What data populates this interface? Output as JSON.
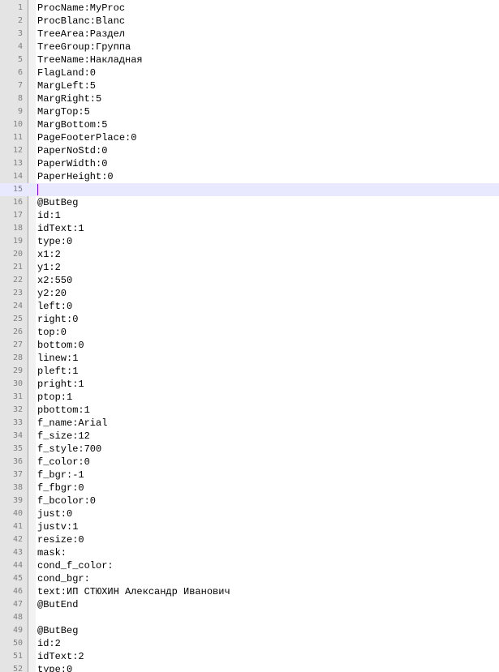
{
  "colors": {
    "gutter_bg": "#e4e4e4",
    "line_number": "#808080",
    "current_line_bg": "#e8e8ff",
    "caret": "#8000ff",
    "text": "#000000"
  },
  "current_line": 15,
  "lines": [
    {
      "n": "1",
      "text": "ProcName:MyProc"
    },
    {
      "n": "2",
      "text": "ProcBlanc:Blanc"
    },
    {
      "n": "3",
      "text": "TreeArea:Раздел"
    },
    {
      "n": "4",
      "text": "TreeGroup:Группа"
    },
    {
      "n": "5",
      "text": "TreeName:Накладная"
    },
    {
      "n": "6",
      "text": "FlagLand:0"
    },
    {
      "n": "7",
      "text": "MargLeft:5"
    },
    {
      "n": "8",
      "text": "MargRight:5"
    },
    {
      "n": "9",
      "text": "MargTop:5"
    },
    {
      "n": "10",
      "text": "MargBottom:5"
    },
    {
      "n": "11",
      "text": "PageFooterPlace:0"
    },
    {
      "n": "12",
      "text": "PaperNoStd:0"
    },
    {
      "n": "13",
      "text": "PaperWidth:0"
    },
    {
      "n": "14",
      "text": "PaperHeight:0"
    },
    {
      "n": "15",
      "text": ""
    },
    {
      "n": "16",
      "text": "@ButBeg"
    },
    {
      "n": "17",
      "text": "id:1"
    },
    {
      "n": "18",
      "text": "idText:1"
    },
    {
      "n": "19",
      "text": "type:0"
    },
    {
      "n": "20",
      "text": "x1:2"
    },
    {
      "n": "21",
      "text": "y1:2"
    },
    {
      "n": "22",
      "text": "x2:550"
    },
    {
      "n": "23",
      "text": "y2:20"
    },
    {
      "n": "24",
      "text": "left:0"
    },
    {
      "n": "25",
      "text": "right:0"
    },
    {
      "n": "26",
      "text": "top:0"
    },
    {
      "n": "27",
      "text": "bottom:0"
    },
    {
      "n": "28",
      "text": "linew:1"
    },
    {
      "n": "29",
      "text": "pleft:1"
    },
    {
      "n": "30",
      "text": "pright:1"
    },
    {
      "n": "31",
      "text": "ptop:1"
    },
    {
      "n": "32",
      "text": "pbottom:1"
    },
    {
      "n": "33",
      "text": "f_name:Arial"
    },
    {
      "n": "34",
      "text": "f_size:12"
    },
    {
      "n": "35",
      "text": "f_style:700"
    },
    {
      "n": "36",
      "text": "f_color:0"
    },
    {
      "n": "37",
      "text": "f_bgr:-1"
    },
    {
      "n": "38",
      "text": "f_fbgr:0"
    },
    {
      "n": "39",
      "text": "f_bcolor:0"
    },
    {
      "n": "40",
      "text": "just:0"
    },
    {
      "n": "41",
      "text": "justv:1"
    },
    {
      "n": "42",
      "text": "resize:0"
    },
    {
      "n": "43",
      "text": "mask:"
    },
    {
      "n": "44",
      "text": "cond_f_color:"
    },
    {
      "n": "45",
      "text": "cond_bgr:"
    },
    {
      "n": "46",
      "text": "text:ИП СТЮХИН Александр Иванович"
    },
    {
      "n": "47",
      "text": "@ButEnd"
    },
    {
      "n": "48",
      "text": ""
    },
    {
      "n": "49",
      "text": "@ButBeg"
    },
    {
      "n": "50",
      "text": "id:2"
    },
    {
      "n": "51",
      "text": "idText:2"
    },
    {
      "n": "52",
      "text": "type:0"
    }
  ]
}
